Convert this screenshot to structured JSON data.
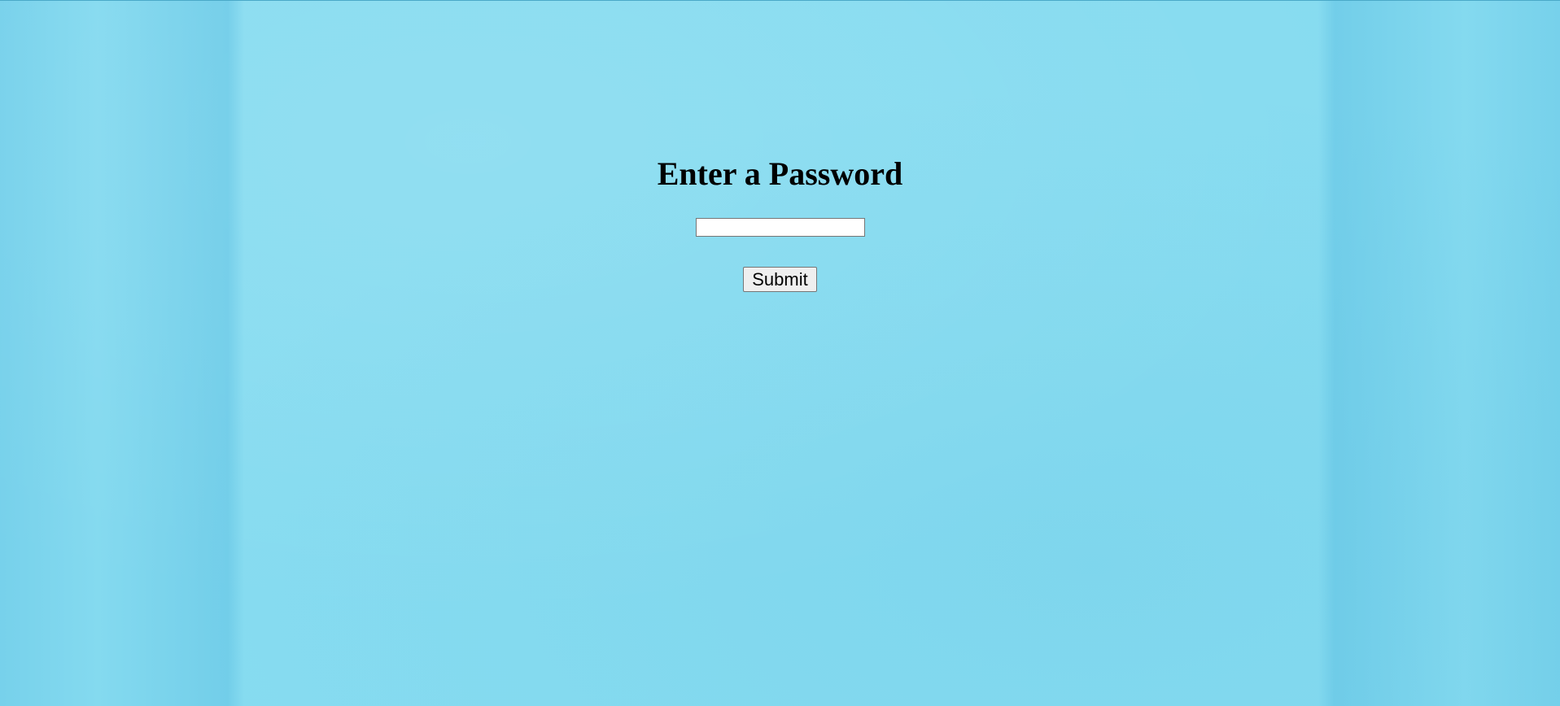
{
  "form": {
    "title": "Enter a Password",
    "password_value": "",
    "submit_label": "Submit"
  },
  "colors": {
    "background": "#86dbf0",
    "button_bg": "#efefef",
    "text": "#000000"
  }
}
